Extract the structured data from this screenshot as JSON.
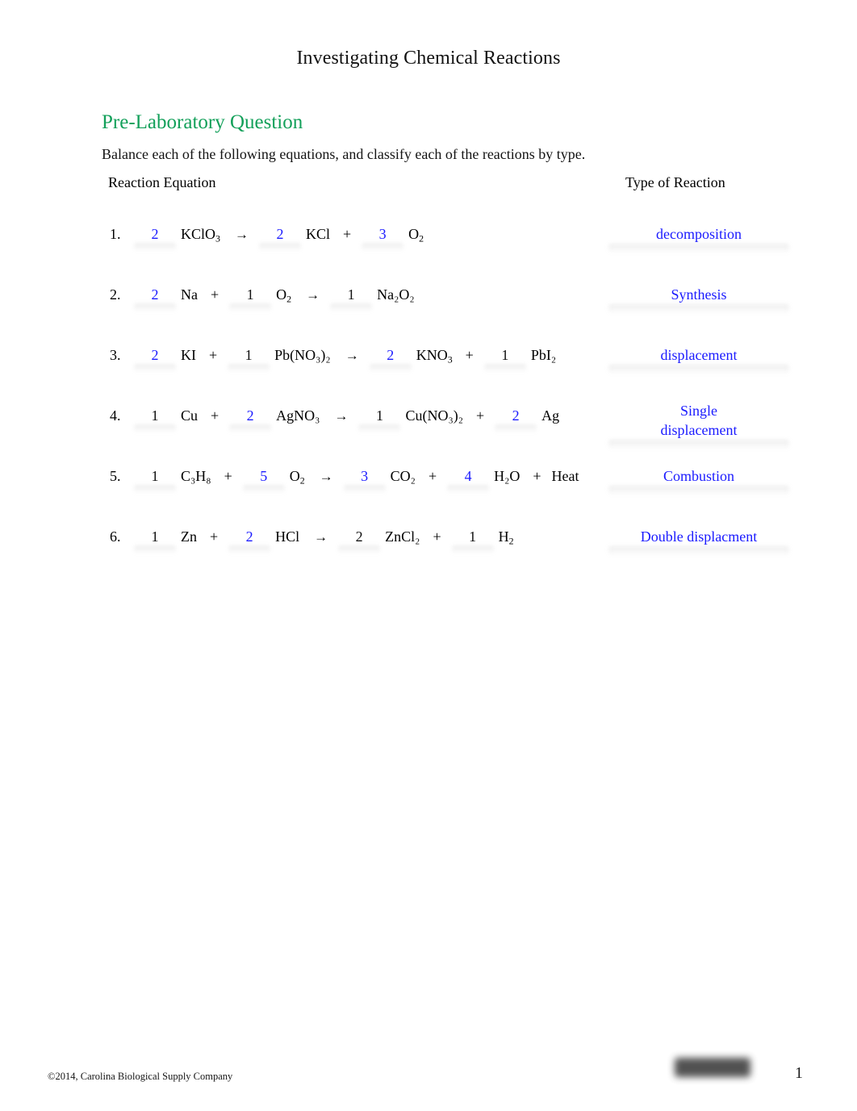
{
  "document": {
    "title": "Investigating Chemical Reactions",
    "section_heading": "Pre-Laboratory Question",
    "instruction": "Balance each of the following equations, and classify each of the reactions by type.",
    "heading_color": "#13a05a",
    "answer_color": "#1a1aff"
  },
  "table": {
    "header_left": "Reaction Equation",
    "header_right": "Type of Reaction",
    "rows": [
      {
        "number": "1.",
        "tokens": [
          {
            "kind": "coef",
            "text": "2",
            "filled": "blue"
          },
          {
            "kind": "species",
            "text": "KClO",
            "sub": "3"
          },
          {
            "kind": "arrow",
            "text": "→"
          },
          {
            "kind": "coef",
            "text": "2",
            "filled": "blue"
          },
          {
            "kind": "species",
            "text": "KCl"
          },
          {
            "kind": "op",
            "text": "+"
          },
          {
            "kind": "coef",
            "text": "3",
            "filled": "blue"
          },
          {
            "kind": "species",
            "text": "O",
            "sub": "2"
          }
        ],
        "type": "decomposition",
        "type_lines": [
          "decomposition"
        ]
      },
      {
        "number": "2.",
        "tokens": [
          {
            "kind": "coef",
            "text": "2",
            "filled": "blue"
          },
          {
            "kind": "species",
            "text": "Na"
          },
          {
            "kind": "op",
            "text": "+"
          },
          {
            "kind": "coef",
            "text": "1",
            "filled": "black"
          },
          {
            "kind": "species",
            "text": "O",
            "sub": "2"
          },
          {
            "kind": "arrow",
            "text": "→"
          },
          {
            "kind": "coef",
            "text": "1",
            "filled": "black"
          },
          {
            "kind": "species",
            "text": "Na₂O₂"
          }
        ],
        "type": "Synthesis",
        "type_lines": [
          "Synthesis"
        ]
      },
      {
        "number": "3.",
        "tokens": [
          {
            "kind": "coef",
            "text": "2",
            "filled": "blue"
          },
          {
            "kind": "species",
            "text": "KI"
          },
          {
            "kind": "op",
            "text": "+"
          },
          {
            "kind": "coef",
            "text": "1",
            "filled": "black"
          },
          {
            "kind": "species",
            "text": "Pb(NO₃)₂"
          },
          {
            "kind": "arrow",
            "text": "→"
          },
          {
            "kind": "coef",
            "text": "2",
            "filled": "blue"
          },
          {
            "kind": "species",
            "text": "KNO",
            "sub": "3"
          },
          {
            "kind": "op",
            "text": "+"
          },
          {
            "kind": "coef",
            "text": "1",
            "filled": "black"
          },
          {
            "kind": "species",
            "text": "PbI₂"
          }
        ],
        "type": "displacement",
        "type_lines": [
          "displacement"
        ]
      },
      {
        "number": "4.",
        "tokens": [
          {
            "kind": "coef",
            "text": "1",
            "filled": "black"
          },
          {
            "kind": "species",
            "text": "Cu"
          },
          {
            "kind": "op",
            "text": "+"
          },
          {
            "kind": "coef",
            "text": "2",
            "filled": "blue"
          },
          {
            "kind": "species",
            "text": "AgNO₃"
          },
          {
            "kind": "arrow",
            "text": "→"
          },
          {
            "kind": "coef",
            "text": "1",
            "filled": "black"
          },
          {
            "kind": "species",
            "text": "Cu(NO₃)₂"
          },
          {
            "kind": "op",
            "text": "+"
          },
          {
            "kind": "coef",
            "text": "2",
            "filled": "blue"
          },
          {
            "kind": "species",
            "text": "Ag"
          }
        ],
        "type": "Single displacement",
        "type_lines": [
          "Single",
          "displacement"
        ]
      },
      {
        "number": "5.",
        "tokens": [
          {
            "kind": "coef",
            "text": "1",
            "filled": "black"
          },
          {
            "kind": "species",
            "text": "C₃H₈"
          },
          {
            "kind": "op",
            "text": "+"
          },
          {
            "kind": "coef",
            "text": "5",
            "filled": "blue"
          },
          {
            "kind": "species",
            "text": "O",
            "sub": "2"
          },
          {
            "kind": "arrow",
            "text": "→"
          },
          {
            "kind": "coef",
            "text": "3",
            "filled": "blue"
          },
          {
            "kind": "species",
            "text": "CO₂"
          },
          {
            "kind": "op",
            "text": "+"
          },
          {
            "kind": "coef",
            "text": "4",
            "filled": "blue"
          },
          {
            "kind": "species",
            "text": "H₂O"
          },
          {
            "kind": "op",
            "text": "+"
          },
          {
            "kind": "species",
            "text": "Heat"
          }
        ],
        "type": "Combustion",
        "type_lines": [
          "Combustion"
        ]
      },
      {
        "number": "6.",
        "tokens": [
          {
            "kind": "coef",
            "text": "1",
            "filled": "black"
          },
          {
            "kind": "species",
            "text": "Zn"
          },
          {
            "kind": "op",
            "text": "+"
          },
          {
            "kind": "coef",
            "text": "2",
            "filled": "blue"
          },
          {
            "kind": "species",
            "text": "HCl"
          },
          {
            "kind": "arrow",
            "text": "→"
          },
          {
            "kind": "coef",
            "text": "2",
            "filled": "black"
          },
          {
            "kind": "species",
            "text": "ZnCl₂"
          },
          {
            "kind": "op",
            "text": "+"
          },
          {
            "kind": "coef",
            "text": "1",
            "filled": "black"
          },
          {
            "kind": "species",
            "text": "H",
            "sub": "2"
          }
        ],
        "type": "Double displacment",
        "type_lines": [
          "Double displacment"
        ]
      }
    ]
  },
  "footer": {
    "copyright": "©2014, Carolina Biological Supply Company",
    "page_number": "1",
    "redaction": "redacted-text-block"
  }
}
